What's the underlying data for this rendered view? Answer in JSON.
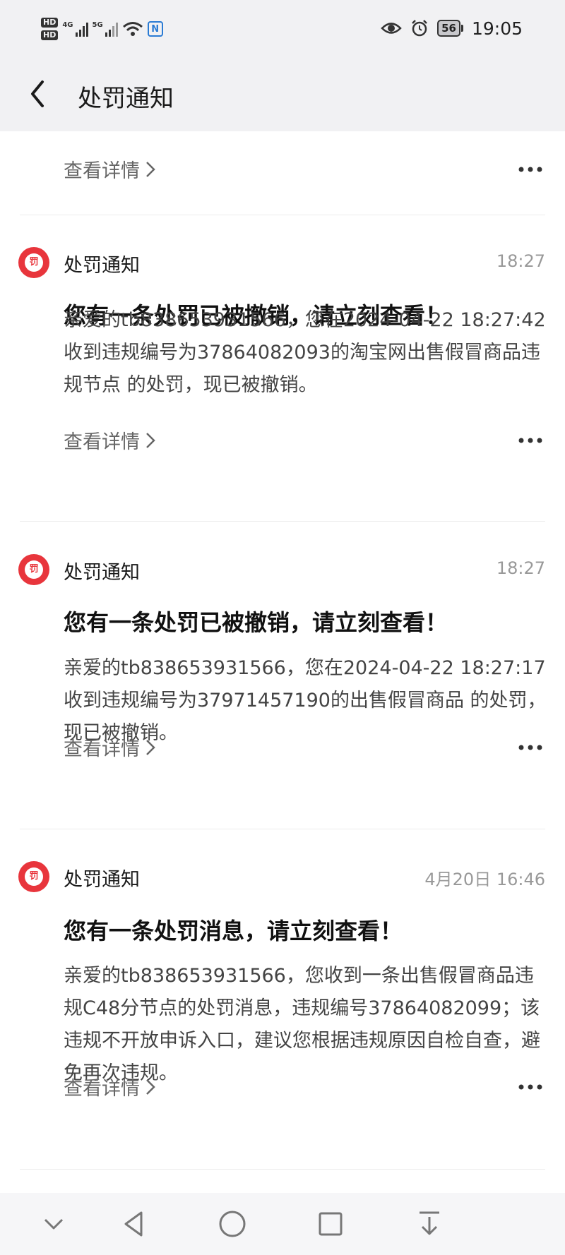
{
  "status_bar": {
    "hd1": "HD",
    "hd2": "HD",
    "net1": "4G",
    "net2": "5G",
    "nfc": "N",
    "battery": "56",
    "time": "19:05",
    "icons": [
      "eye-icon",
      "alarm-icon"
    ]
  },
  "header": {
    "title": "处罚通知"
  },
  "detail_label": "查看详情",
  "messages": [
    {
      "sender": "处罚通知",
      "time": "18:27",
      "title": "您有一条处罚已被撤销，请立刻查看！",
      "body": "亲爱的tb838653931566，您在2024-04-22 18:27:42收到违规编号为37864082093的淘宝网出售假冒商品违规节点 的处罚，现已被撤销。",
      "icon_text": "罚"
    },
    {
      "sender": "处罚通知",
      "time": "18:27",
      "title": "您有一条处罚已被撤销，请立刻查看！",
      "body": "亲爱的tb838653931566，您在2024-04-22 18:27:17收到违规编号为37971457190的出售假冒商品 的处罚，现已被撤销。",
      "icon_text": "罚"
    },
    {
      "sender": "处罚通知",
      "time": "4月20日 16:46",
      "title": "您有一条处罚消息，请立刻查看！",
      "body": "亲爱的tb838653931566，您收到一条出售假冒商品违规C48分节点的处罚消息，违规编号37864082099；该违规不开放申诉入口，建议您根据违规原因自检自查，避免再次违规。",
      "icon_text": "罚"
    }
  ],
  "colors": {
    "accent_red": "#e8353c",
    "header_bg": "#f1f1f3"
  }
}
